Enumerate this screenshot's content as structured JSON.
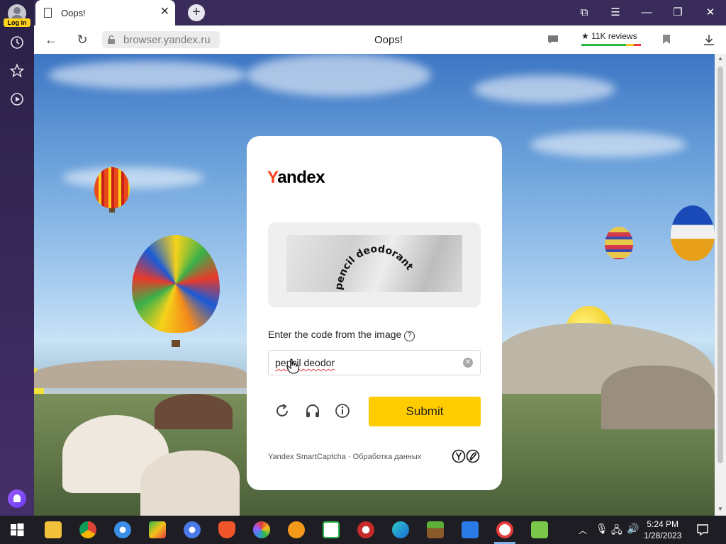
{
  "sidebar": {
    "login_label": "Log in"
  },
  "tab": {
    "title": "Oops!",
    "close_glyph": "✕",
    "new_tab_glyph": "+"
  },
  "window_controls": {
    "collections_glyph": "⧉",
    "menu_glyph": "☰",
    "minimize_glyph": "—",
    "restore_glyph": "❐",
    "close_glyph": "✕"
  },
  "address_bar": {
    "back_glyph": "←",
    "reload_glyph": "↻",
    "url": "browser.yandex.ru",
    "page_title": "Oops!",
    "reviews": "★ 11K reviews"
  },
  "captcha": {
    "logo_first": "Y",
    "logo_rest": "andex",
    "image_text": "pencil deodorant",
    "instruction": "Enter the code from the image",
    "help_glyph": "?",
    "input_value": "pencil deodor",
    "clear_glyph": "✕",
    "submit_label": "Submit",
    "footer": "Yandex SmartCaptcha · Обработка данных"
  },
  "taskbar": {
    "time": "5:24 PM",
    "date": "1/28/2023"
  },
  "colors": {
    "yandex_red": "#fc3f1d",
    "submit_yellow": "#ffcc00",
    "sidebar_purple": "#3a2c5a"
  }
}
